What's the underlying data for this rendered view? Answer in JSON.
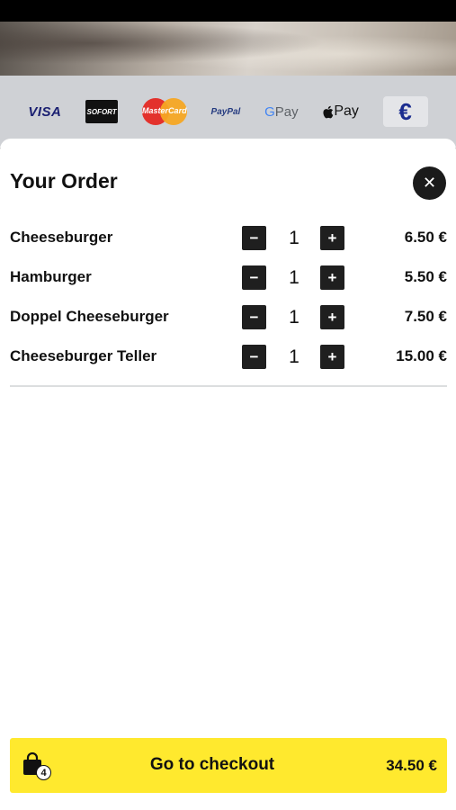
{
  "payment_methods": {
    "visa": "VISA",
    "sofort": "SOFORT",
    "mastercard": "MasterCard",
    "paypal": "PayPal",
    "gpay_g": "G",
    "gpay_rest": "Pay",
    "applepay": "Pay",
    "currency": "€"
  },
  "sheet": {
    "title": "Your Order",
    "close_icon": "close-icon"
  },
  "items": [
    {
      "name": "Cheeseburger",
      "qty": "1",
      "price": "6.50 €"
    },
    {
      "name": "Hamburger",
      "qty": "1",
      "price": "5.50 €"
    },
    {
      "name": "Doppel Cheeseburger",
      "qty": "1",
      "price": "7.50 €"
    },
    {
      "name": "Cheeseburger Teller",
      "qty": "1",
      "price": "15.00 €"
    }
  ],
  "controls": {
    "minus": "−",
    "plus": "+",
    "close": "✕"
  },
  "checkout": {
    "label": "Go to checkout",
    "total": "34.50 €",
    "bag_count": "4",
    "bag_icon": "shopping-bag-icon"
  },
  "colors": {
    "checkout_accent": "#ffe92e",
    "control_dark": "#1f1f1f"
  }
}
